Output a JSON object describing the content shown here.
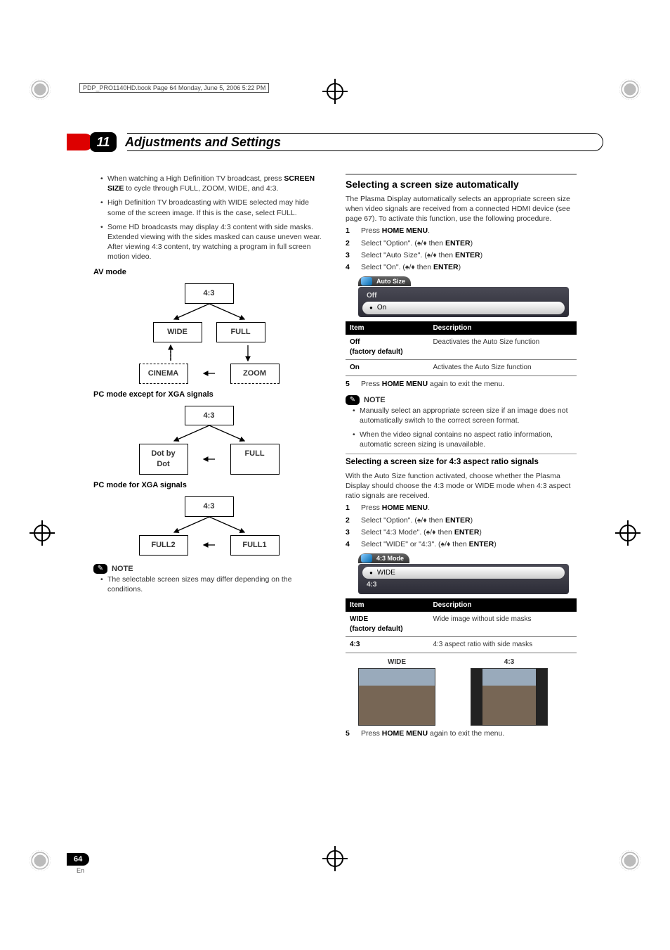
{
  "meta": {
    "topline": "PDP_PRO1140HD.book  Page 64  Monday, June 5, 2006  5:22 PM"
  },
  "chapter": {
    "num": "11",
    "title": "Adjustments and Settings"
  },
  "left": {
    "bullets": [
      {
        "pre": "When watching a High Definition TV broadcast, press ",
        "bold": "SCREEN SIZE",
        "post": " to cycle through FULL, ZOOM, WIDE, and 4:3."
      },
      {
        "text": "High Definition TV broadcasting with WIDE selected may hide some of the screen image. If this is the case, select FULL."
      },
      {
        "text": "Some HD broadcasts may display 4:3 content with side masks. Extended viewing with the sides masked can cause uneven wear. After viewing 4:3 content, try watching a program in full screen motion video."
      }
    ],
    "avmode_h": "AV mode",
    "av": {
      "top": "4:3",
      "wide": "WIDE",
      "full": "FULL",
      "cinema": "CINEMA",
      "zoom": "ZOOM"
    },
    "pc1_h": "PC mode except for XGA signals",
    "pc1": {
      "top": "4:3",
      "dot": "Dot by\nDot",
      "full": "FULL"
    },
    "pc2_h": "PC mode for XGA signals",
    "pc2": {
      "top": "4:3",
      "f2": "FULL2",
      "f1": "FULL1"
    },
    "note_h": "NOTE",
    "note_items": [
      "The selectable screen sizes may differ depending on the conditions."
    ]
  },
  "right": {
    "sec1_h": "Selecting a screen size automatically",
    "sec1_intro": "The Plasma Display automatically selects an appropriate screen size when video signals are received from a connected HDMI device (see page 67). To activate this function, use the following procedure.",
    "steps1": [
      {
        "n": "1",
        "pre": "Press ",
        "b": "HOME MENU",
        "post": "."
      },
      {
        "n": "2",
        "pre": "Select \"Option\". (",
        "arrows": true,
        "mid": " then ",
        "b": "ENTER",
        "post": ")"
      },
      {
        "n": "3",
        "pre": "Select \"Auto Size\". (",
        "arrows": true,
        "mid": " then ",
        "b": "ENTER",
        "post": ")"
      },
      {
        "n": "4",
        "pre": "Select \"On\". (",
        "arrows": true,
        "mid": " then ",
        "b": "ENTER",
        "post": ")"
      }
    ],
    "osd1": {
      "title": "Auto Size",
      "rows": [
        "Off",
        "On"
      ],
      "selected": 1
    },
    "table1": {
      "headers": [
        "Item",
        "Description"
      ],
      "rows": [
        [
          "Off\n(factory default)",
          "Deactivates the Auto Size function"
        ],
        [
          "On",
          "Activates the Auto Size function"
        ]
      ]
    },
    "step1_end": {
      "n": "5",
      "pre": "Press ",
      "b": "HOME MENU",
      "post": " again to exit the menu."
    },
    "note1_h": "NOTE",
    "note1_items": [
      "Manually select an appropriate screen size if an image does not automatically switch to the correct screen format.",
      "When the video signal contains no aspect ratio information, automatic screen sizing is unavailable."
    ],
    "sec2_h": "Selecting a screen size for 4:3 aspect ratio signals",
    "sec2_intro": "With the Auto Size function activated, choose whether the Plasma Display should choose the 4:3 mode or WIDE mode when 4:3 aspect ratio signals are received.",
    "steps2": [
      {
        "n": "1",
        "pre": "Press ",
        "b": "HOME MENU",
        "post": "."
      },
      {
        "n": "2",
        "pre": "Select \"Option\". (",
        "arrows": true,
        "mid": " then ",
        "b": "ENTER",
        "post": ")"
      },
      {
        "n": "3",
        "pre": "Select \"4:3 Mode\". (",
        "arrows": true,
        "mid": " then ",
        "b": "ENTER",
        "post": ")"
      },
      {
        "n": "4",
        "pre": "Select \"WIDE\" or \"4:3\". (",
        "arrows": true,
        "mid": " then ",
        "b": "ENTER",
        "post": ")"
      }
    ],
    "osd2": {
      "title": "4:3 Mode",
      "rows": [
        "WIDE",
        "4:3"
      ],
      "selected": 0
    },
    "table2": {
      "headers": [
        "Item",
        "Description"
      ],
      "rows": [
        [
          "WIDE\n(factory default)",
          "Wide image without side masks"
        ],
        [
          "4:3",
          "4:3 aspect ratio with side masks"
        ]
      ]
    },
    "samples": {
      "wide": "WIDE",
      "four": "4:3"
    },
    "step2_end": {
      "n": "5",
      "pre": "Press ",
      "b": "HOME MENU",
      "post": " again to exit the menu."
    }
  },
  "page": {
    "num": "64",
    "lang": "En"
  }
}
